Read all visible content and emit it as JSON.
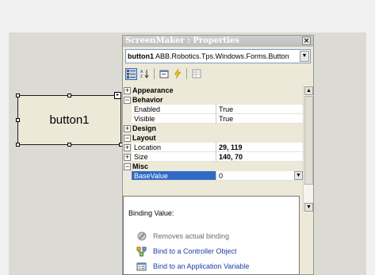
{
  "designer": {
    "button_text": "button1"
  },
  "properties_window": {
    "title": "ScreenMaker : Properties",
    "close_glyph": "×",
    "object_name": "button1",
    "object_type": "ABB.Robotics.Tps.Windows.Forms.Button",
    "toolbar": [
      "categorized-icon",
      "alphabetical-icon",
      "property-pages-icon",
      "events-icon",
      "property-grid-icon"
    ],
    "categories": [
      {
        "label": "Appearance",
        "expanded": false
      },
      {
        "label": "Behavior",
        "expanded": true,
        "properties": [
          {
            "name": "Enabled",
            "value": "True"
          },
          {
            "name": "Visible",
            "value": "True"
          }
        ]
      },
      {
        "label": "Design",
        "expanded": false
      },
      {
        "label": "Layout",
        "expanded": true,
        "properties": [
          {
            "name": "Location",
            "value": "29, 119"
          },
          {
            "name": "Size",
            "value": "140, 70"
          }
        ]
      },
      {
        "label": "Misc",
        "expanded": true,
        "properties": [
          {
            "name": "BaseValue",
            "value": "0",
            "selected": true
          }
        ]
      }
    ]
  },
  "binding_popup": {
    "title": "Binding Value:",
    "items": [
      {
        "label": "Removes actual binding",
        "enabled": false
      },
      {
        "label": "Bind to a Controller Object",
        "enabled": true
      },
      {
        "label": "Bind to an Application Variable",
        "enabled": true
      }
    ]
  },
  "colors": {
    "selection": "#316ac5",
    "link": "#1e3ea7"
  }
}
